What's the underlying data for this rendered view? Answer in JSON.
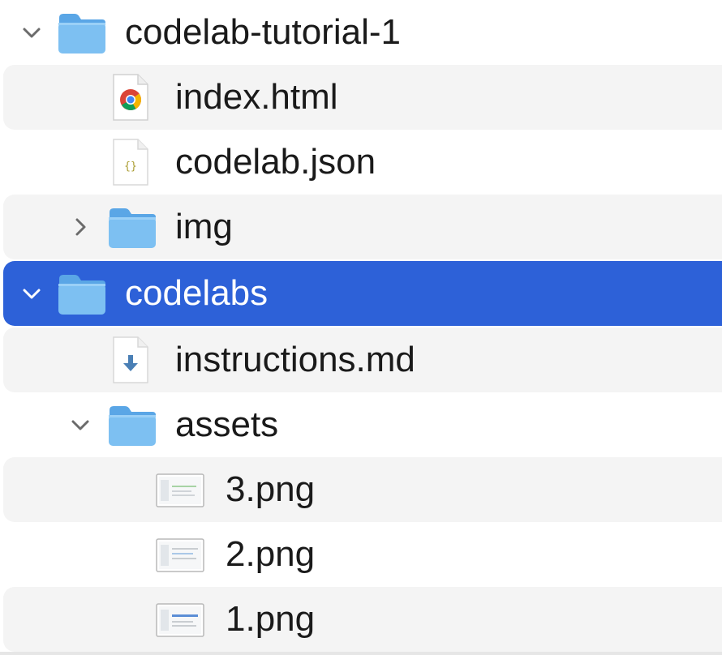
{
  "tree": {
    "items": [
      {
        "label": "codelab-tutorial-1",
        "type": "folder",
        "depth": 0,
        "expanded": true,
        "icon": "folder-icon"
      },
      {
        "label": "index.html",
        "type": "file",
        "depth": 1,
        "icon": "chrome-html-file-icon"
      },
      {
        "label": "codelab.json",
        "type": "file",
        "depth": 1,
        "icon": "json-file-icon"
      },
      {
        "label": "img",
        "type": "folder",
        "depth": 1,
        "expanded": false,
        "icon": "folder-icon"
      },
      {
        "label": "codelabs",
        "type": "folder",
        "depth": 0,
        "expanded": true,
        "selected": true,
        "icon": "folder-icon"
      },
      {
        "label": "instructions.md",
        "type": "file",
        "depth": 1,
        "icon": "markdown-file-icon"
      },
      {
        "label": "assets",
        "type": "folder",
        "depth": 1,
        "expanded": true,
        "icon": "folder-icon"
      },
      {
        "label": "3.png",
        "type": "file",
        "depth": 2,
        "icon": "image-file-icon"
      },
      {
        "label": "2.png",
        "type": "file",
        "depth": 2,
        "icon": "image-file-icon"
      },
      {
        "label": "1.png",
        "type": "file",
        "depth": 2,
        "icon": "image-file-icon"
      }
    ]
  },
  "colors": {
    "selection": "#2d61d8",
    "alternate_row": "#f4f4f4",
    "folder_blue": "#6cb4ee",
    "text": "#1a1a1a"
  }
}
